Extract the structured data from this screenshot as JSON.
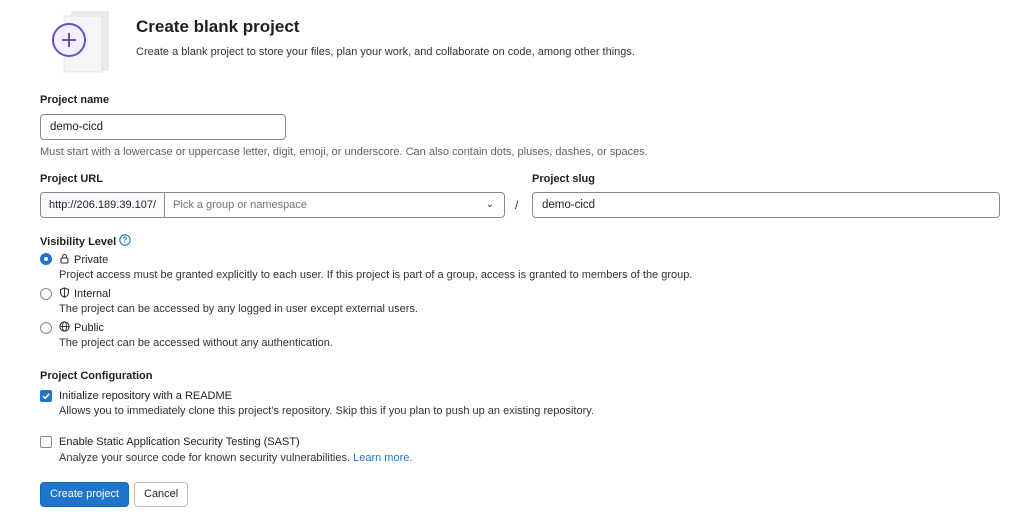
{
  "header": {
    "title": "Create blank project",
    "description": "Create a blank project to store your files, plan your work, and collaborate on code, among other things."
  },
  "project_name": {
    "label": "Project name",
    "value": "demo-cicd",
    "help": "Must start with a lowercase or uppercase letter, digit, emoji, or underscore. Can also contain dots, pluses, dashes, or spaces."
  },
  "project_url": {
    "label": "Project URL",
    "prefix": "http://206.189.39.107/",
    "placeholder": "Pick a group or namespace",
    "separator": "/"
  },
  "project_slug": {
    "label": "Project slug",
    "value": "demo-cicd"
  },
  "visibility": {
    "label": "Visibility Level",
    "options": [
      {
        "label": "Private",
        "icon": "lock-icon",
        "checked": true,
        "description": "Project access must be granted explicitly to each user. If this project is part of a group, access is granted to members of the group."
      },
      {
        "label": "Internal",
        "icon": "shield-icon",
        "checked": false,
        "description": "The project can be accessed by any logged in user except external users."
      },
      {
        "label": "Public",
        "icon": "globe-icon",
        "checked": false,
        "description": "The project can be accessed without any authentication."
      }
    ]
  },
  "configuration": {
    "label": "Project Configuration",
    "readme": {
      "label": "Initialize repository with a README",
      "checked": true,
      "description": "Allows you to immediately clone this project’s repository. Skip this if you plan to push up an existing repository."
    },
    "sast": {
      "label": "Enable Static Application Security Testing (SAST)",
      "checked": false,
      "description": "Analyze your source code for known security vulnerabilities.",
      "link": "Learn more."
    }
  },
  "actions": {
    "create": "Create project",
    "cancel": "Cancel"
  },
  "colors": {
    "accent": "#1f75cb",
    "illustration": "#6b4fbb"
  }
}
